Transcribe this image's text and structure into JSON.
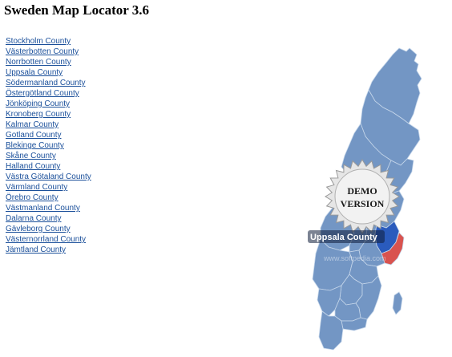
{
  "app": {
    "title": "Sweden Map Locator 3.6"
  },
  "counties": [
    {
      "label": "Stockholm County"
    },
    {
      "label": "Västerbotten County"
    },
    {
      "label": "Norrbotten County"
    },
    {
      "label": "Uppsala County"
    },
    {
      "label": "Södermanland County"
    },
    {
      "label": "Östergötland County"
    },
    {
      "label": "Jönköping County"
    },
    {
      "label": "Kronoberg County"
    },
    {
      "label": "Kalmar County"
    },
    {
      "label": "Gotland County"
    },
    {
      "label": "Blekinge County"
    },
    {
      "label": "Skåne County"
    },
    {
      "label": "Halland County"
    },
    {
      "label": "Västra Götaland County"
    },
    {
      "label": "Värmland County"
    },
    {
      "label": "Örebro County"
    },
    {
      "label": "Västmanland County"
    },
    {
      "label": "Dalarna County"
    },
    {
      "label": "Gävleborg County"
    },
    {
      "label": "Västernorrland County"
    },
    {
      "label": "Jämtland County"
    }
  ],
  "map": {
    "demo_badge": {
      "line1": "DEMO",
      "line2": "VERSION"
    },
    "hover_tooltip": "Uppsala County",
    "watermark": "www.softpedia.com",
    "colors": {
      "county_fill": "#7396c4",
      "county_border": "#c5d6ea",
      "highlight": "#2a5bbd",
      "selected": "#d9534f",
      "link": "#1a4f9a"
    }
  }
}
